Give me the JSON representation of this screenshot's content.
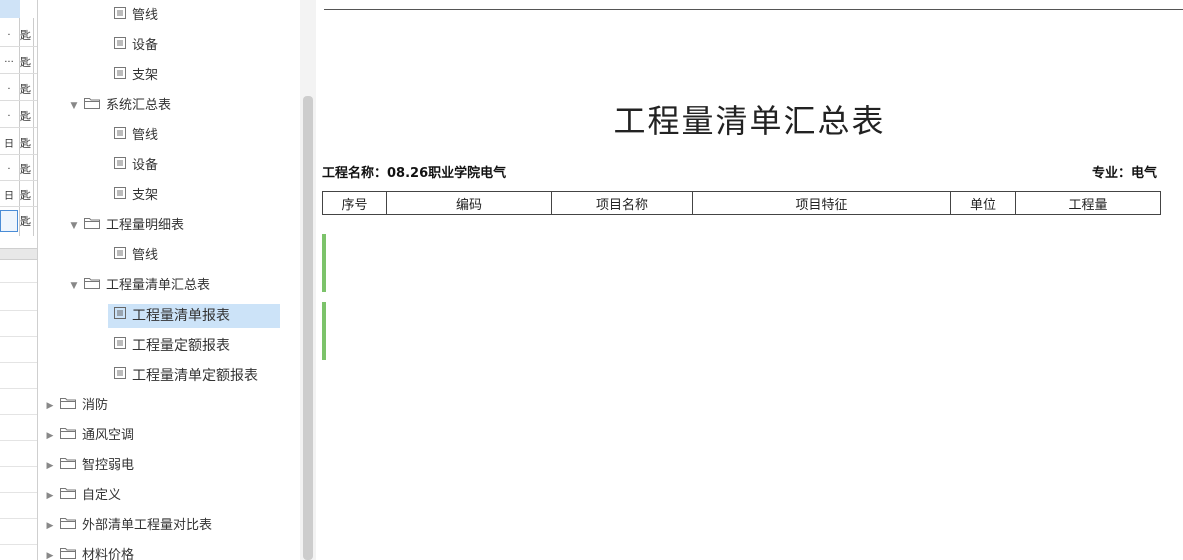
{
  "left_grid": {
    "rows": [
      {
        "a": ".",
        "b": "匙"
      },
      {
        "a": "...",
        "b": "匙"
      },
      {
        "a": ".",
        "b": "匙"
      },
      {
        "a": ".",
        "b": "匙"
      },
      {
        "a": "日",
        "b": "匙"
      },
      {
        "a": ".",
        "b": "匙"
      },
      {
        "a": "日",
        "b": "匙"
      },
      {
        "a": "",
        "b": "匙"
      }
    ]
  },
  "tree": {
    "items": [
      {
        "label": "管线",
        "type": "doc"
      },
      {
        "label": "设备",
        "type": "doc"
      },
      {
        "label": "支架",
        "type": "doc"
      },
      {
        "label": "系统汇总表",
        "type": "folder",
        "state": "expanded"
      },
      {
        "label": "管线",
        "type": "doc"
      },
      {
        "label": "设备",
        "type": "doc"
      },
      {
        "label": "支架",
        "type": "doc"
      },
      {
        "label": "工程量明细表",
        "type": "folder",
        "state": "expanded"
      },
      {
        "label": "管线",
        "type": "doc"
      },
      {
        "label": "工程量清单汇总表",
        "type": "folder",
        "state": "expanded"
      },
      {
        "label": "工程量清单报表",
        "type": "doc",
        "selected": true
      },
      {
        "label": "工程量定额报表",
        "type": "doc"
      },
      {
        "label": "工程量清单定额报表",
        "type": "doc"
      },
      {
        "label": "消防",
        "type": "folder",
        "state": "collapsed"
      },
      {
        "label": "通风空调",
        "type": "folder",
        "state": "collapsed"
      },
      {
        "label": "智控弱电",
        "type": "folder",
        "state": "collapsed"
      },
      {
        "label": "自定义",
        "type": "folder",
        "state": "collapsed"
      },
      {
        "label": "外部清单工程量对比表",
        "type": "folder",
        "state": "collapsed"
      },
      {
        "label": "材料价格",
        "type": "folder",
        "state": "collapsed"
      }
    ]
  },
  "report": {
    "title": "工程量清单汇总表",
    "project_label": "工程名称：",
    "project_name": "08.26职业学院电气",
    "major_label": "专业：",
    "major_value": "电气",
    "columns": [
      "序号",
      "编码",
      "项目名称",
      "项目特征",
      "单位",
      "工程量"
    ]
  },
  "colors": {
    "selection": "#cce3f8",
    "accent_green": "#7cc36a",
    "scrollbar_thumb": "#cdcdcd"
  }
}
